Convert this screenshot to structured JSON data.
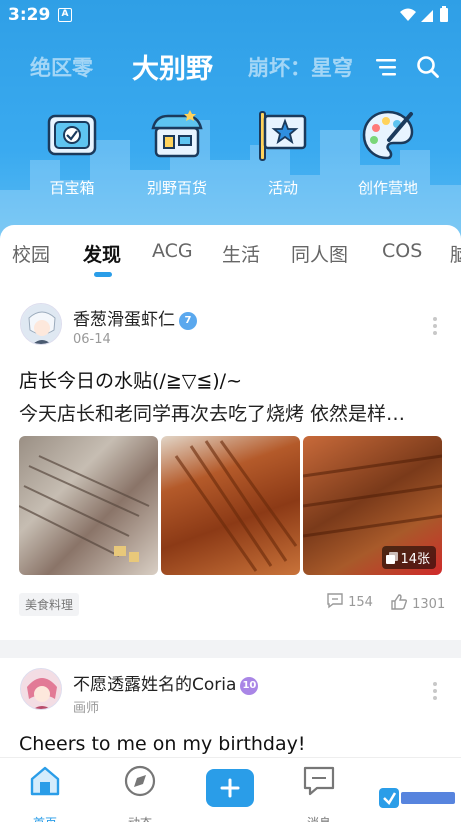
{
  "status_bar": {
    "time": "3:29",
    "notification_letter": "A"
  },
  "top_nav": {
    "tabs": [
      {
        "label": "绝区零",
        "active": false
      },
      {
        "label": "大别野",
        "active": true
      },
      {
        "label": "崩坏：星穹",
        "active": false
      }
    ],
    "menu_icon": "menu-lines-icon",
    "search_icon": "search-icon"
  },
  "quick_entries": [
    {
      "label": "百宝箱",
      "icon": "toolbox-icon"
    },
    {
      "label": "别野百货",
      "icon": "shop-icon"
    },
    {
      "label": "活动",
      "icon": "activity-flag-icon"
    },
    {
      "label": "创作营地",
      "icon": "palette-icon"
    }
  ],
  "categories": [
    "校园",
    "发现",
    "ACG",
    "生活",
    "同人图",
    "COS",
    "脑"
  ],
  "active_category": "发现",
  "posts": [
    {
      "author": "香葱滑蛋虾仁",
      "level": "7",
      "date": "06-14",
      "title": "店长今日の水贴(/≧▽≦)/~",
      "excerpt": "今天店长和老同学再次去吃了烧烤 依然是样…",
      "image_count": "14张",
      "tag": "美食料理",
      "comments": "154",
      "likes": "1301"
    },
    {
      "author": "不愿透露姓名的Coria",
      "level": "10",
      "subtitle": "画师",
      "title": "Cheers to me on my birthday!"
    }
  ],
  "bottom_nav": {
    "items": [
      {
        "label": "首页",
        "active": true
      },
      {
        "label": "动态",
        "active": false
      },
      {
        "label": "",
        "active": false
      },
      {
        "label": "消息",
        "active": false
      }
    ]
  },
  "colors": {
    "accent": "#2a9de8",
    "header_top": "#2f9fe6"
  }
}
